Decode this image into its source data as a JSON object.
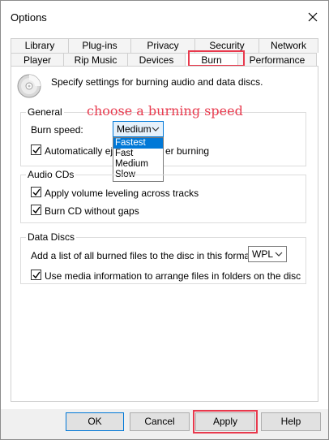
{
  "window": {
    "title": "Options"
  },
  "tabs_back": [
    "Library",
    "Plug-ins",
    "Privacy",
    "Security",
    "Network"
  ],
  "tabs_front": [
    "Player",
    "Rip Music",
    "Devices",
    "Burn",
    "Performance"
  ],
  "selected_tab": "Burn",
  "intro_text": "Specify settings for burning audio and data discs.",
  "general": {
    "title": "General",
    "burn_speed_label": "Burn speed:",
    "burn_speed_value": "Medium",
    "burn_speed_options": [
      "Fastest",
      "Fast",
      "Medium",
      "Slow"
    ],
    "highlighted_option": "Fastest",
    "auto_eject_label": "Automatically eje",
    "auto_eject_label_tail": "er burning",
    "auto_eject_checked": true
  },
  "audio_cds": {
    "title": "Audio CDs",
    "volume_leveling_label": "Apply volume leveling across tracks",
    "volume_leveling_checked": true,
    "no_gaps_label": "Burn CD without gaps",
    "no_gaps_checked": true
  },
  "data_discs": {
    "title": "Data Discs",
    "list_format_label": "Add a list of all burned files to the disc in this format:",
    "list_format_value": "WPL",
    "media_info_label": "Use media information to arrange files in folders on the disc",
    "media_info_checked": true
  },
  "annotation": "choose a burning speed",
  "buttons": {
    "ok": "OK",
    "cancel": "Cancel",
    "apply": "Apply",
    "help": "Help"
  },
  "colors": {
    "annotation": "#e8394d",
    "selection": "#0078d7"
  }
}
